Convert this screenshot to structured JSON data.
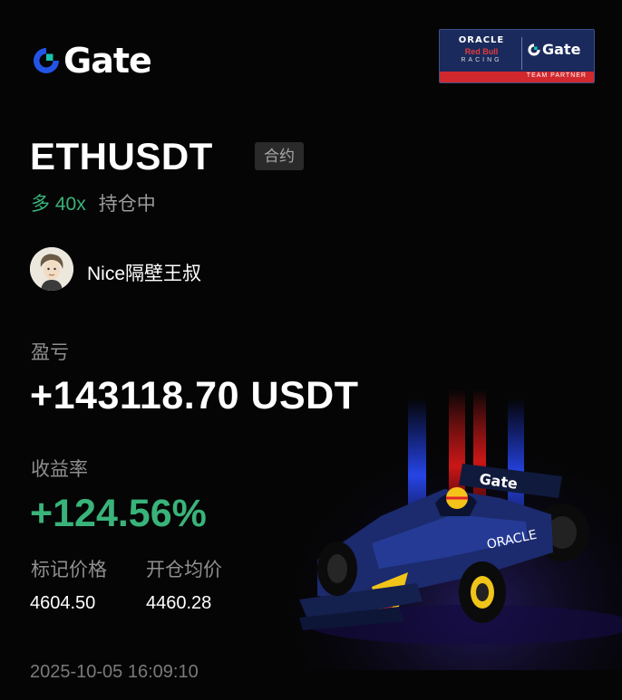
{
  "brand": {
    "name": "Gate",
    "accent": "#2354e6",
    "teal": "#17c2b0"
  },
  "partner": {
    "line1": "ORACLE",
    "line2": "Red Bull",
    "line3": "RACING",
    "brand": "Gate",
    "strip": "TEAM PARTNER"
  },
  "position": {
    "symbol": "ETHUSDT",
    "tag": "合约",
    "side": "多 40x",
    "status": "持仓中"
  },
  "user": {
    "name": "Nice隔壁王叔"
  },
  "pnl": {
    "label": "盈亏",
    "value": "+143118.70 USDT"
  },
  "roi": {
    "label": "收益率",
    "value": "+124.56%"
  },
  "mark_price": {
    "label": "标记价格",
    "value": "4604.50"
  },
  "entry_price": {
    "label": "开仓均价",
    "value": "4460.28"
  },
  "timestamp": "2025-10-05 16:09:10",
  "colors": {
    "profit": "#39b37a",
    "background": "#050505"
  }
}
